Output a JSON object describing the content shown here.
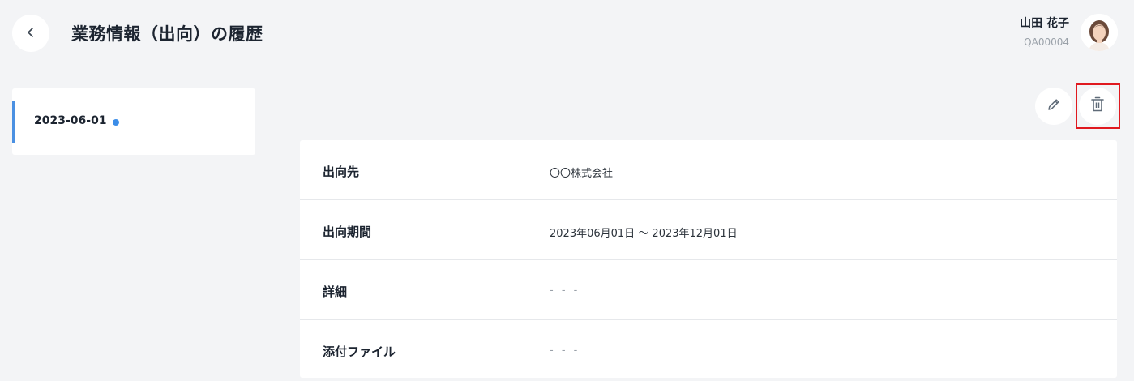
{
  "header": {
    "title": "業務情報（出向）の履歴",
    "user": {
      "name": "山田 花子",
      "id": "QA00004"
    }
  },
  "history": {
    "items": [
      {
        "date": "2023-06-01",
        "selected": true
      }
    ]
  },
  "details": {
    "rows": [
      {
        "label": "出向先",
        "value": "〇〇株式会社"
      },
      {
        "label": "出向期間",
        "value": "2023年06月01日 〜 2023年12月01日"
      },
      {
        "label": "詳細",
        "value": "- - -"
      },
      {
        "label": "添付ファイル",
        "value": "- - -"
      }
    ]
  },
  "colors": {
    "accent": "#4a90e2",
    "status_dot": "#3b8de8",
    "highlight": "#e0191f",
    "background": "#f3f4f6"
  },
  "icons": {
    "back": "chevron-left-icon",
    "edit": "pencil-icon",
    "delete": "trash-icon"
  }
}
